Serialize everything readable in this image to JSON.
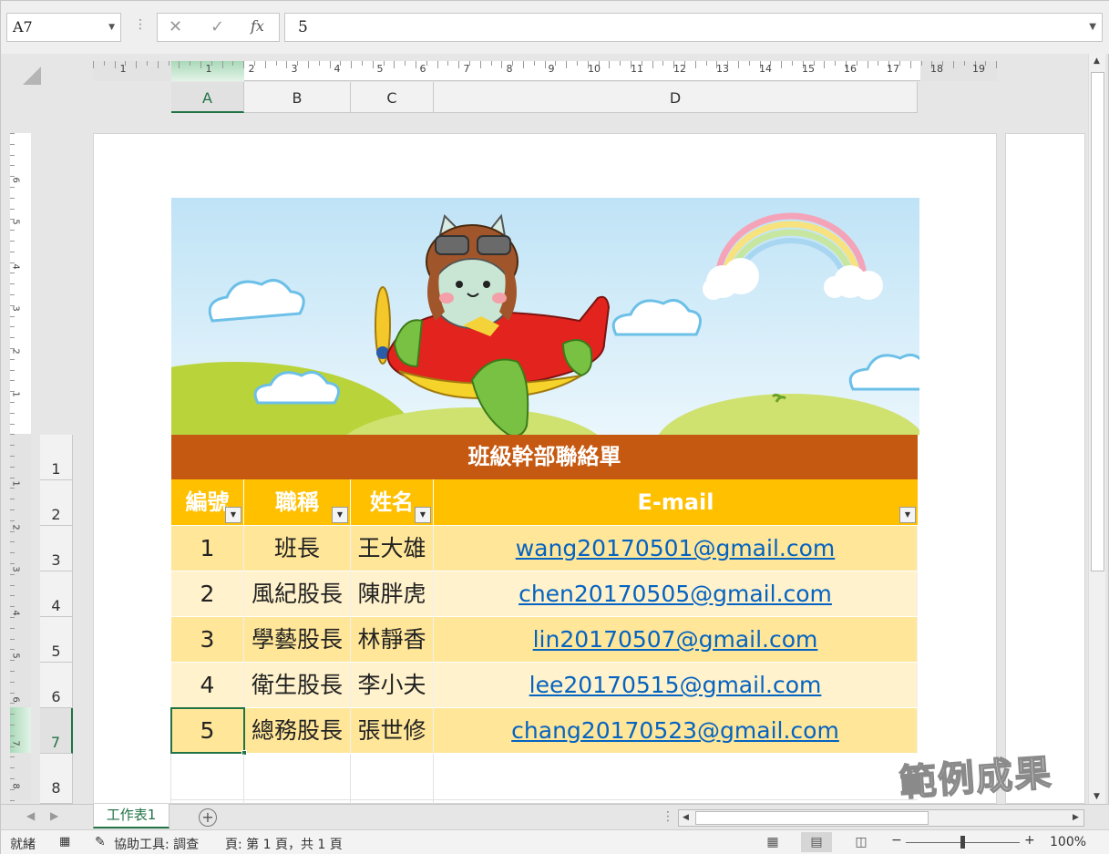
{
  "formula_bar": {
    "name_box": "A7",
    "cancel_symbol": "✕",
    "enter_symbol": "✓",
    "function_symbol": "fx",
    "value": "5"
  },
  "ruler": {
    "numbers": [
      "1",
      "1",
      "2",
      "3",
      "4",
      "5",
      "6",
      "7",
      "8",
      "9",
      "10",
      "11",
      "12",
      "13",
      "14",
      "15",
      "16",
      "17",
      "18",
      "19"
    ],
    "vertical_numbers": [
      "6",
      "5",
      "4",
      "3",
      "2",
      "1",
      "1",
      "2",
      "3",
      "4",
      "5",
      "6",
      "7",
      "8"
    ]
  },
  "columns": [
    "A",
    "B",
    "C",
    "D"
  ],
  "rows": [
    "1",
    "2",
    "3",
    "4",
    "5",
    "6",
    "7",
    "8"
  ],
  "sheet": {
    "title": "班級幹部聯絡單",
    "headers": [
      "編號",
      "職稱",
      "姓名",
      "E-mail"
    ],
    "data": [
      {
        "no": "1",
        "role": "班長",
        "name": "王大雄",
        "email": "wang20170501@gmail.com"
      },
      {
        "no": "2",
        "role": "風紀股長",
        "name": "陳胖虎",
        "email": "chen20170505@gmail.com"
      },
      {
        "no": "3",
        "role": "學藝股長",
        "name": "林靜香",
        "email": "lin20170507@gmail.com"
      },
      {
        "no": "4",
        "role": "衛生股長",
        "name": "李小夫",
        "email": "lee20170515@gmail.com"
      },
      {
        "no": "5",
        "role": "總務股長",
        "name": "張世修",
        "email": "chang20170523@gmail.com"
      }
    ]
  },
  "tabs": {
    "sheet_name": "工作表1",
    "add": "+"
  },
  "status": {
    "ready": "就緒",
    "accessibility": "協助工具: 調查",
    "page_info": "頁: 第 1 頁，共 1 頁",
    "zoom_minus": "−",
    "zoom_plus": "+",
    "zoom": "100%"
  },
  "watermark": "範例成果",
  "colors": {
    "title_bg": "#c65911",
    "header_bg": "#ffc000",
    "row_odd": "#ffe699",
    "row_even": "#fff2cc",
    "link": "#0563c1",
    "excel_green": "#217346"
  },
  "icons": [
    "chevron-down-icon",
    "cancel-icon",
    "check-icon",
    "function-icon",
    "scroll-up-icon",
    "scroll-down-icon",
    "scroll-left-icon",
    "scroll-right-icon",
    "macro-record-icon",
    "accessibility-icon",
    "normal-view-icon",
    "page-layout-icon",
    "page-break-icon",
    "add-sheet-icon",
    "filter-dropdown-icon"
  ]
}
